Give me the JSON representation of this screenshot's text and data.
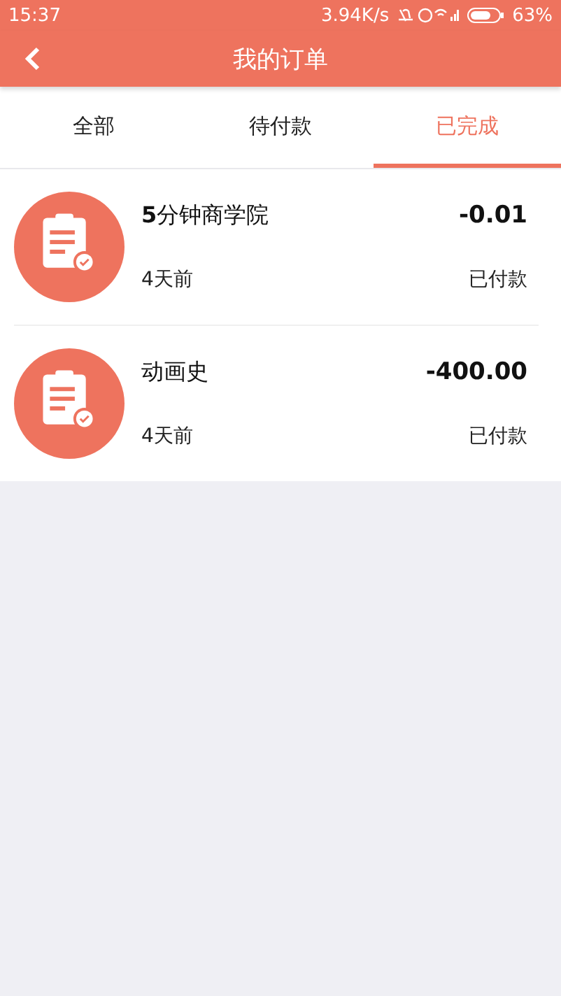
{
  "status_bar": {
    "time": "15:37",
    "speed": "3.94K/s",
    "battery_level": "63%"
  },
  "header": {
    "title": "我的订单"
  },
  "tabs": [
    {
      "label": "全部",
      "selected": false
    },
    {
      "label": "待付款",
      "selected": false
    },
    {
      "label": "已完成",
      "selected": true
    }
  ],
  "orders": [
    {
      "title": "**5**分钟商学院",
      "amount": "-0.01",
      "time": "4天前",
      "status": "已付款"
    },
    {
      "title": "动画史",
      "amount": "-400.00",
      "time": "4天前",
      "status": "已付款"
    }
  ]
}
